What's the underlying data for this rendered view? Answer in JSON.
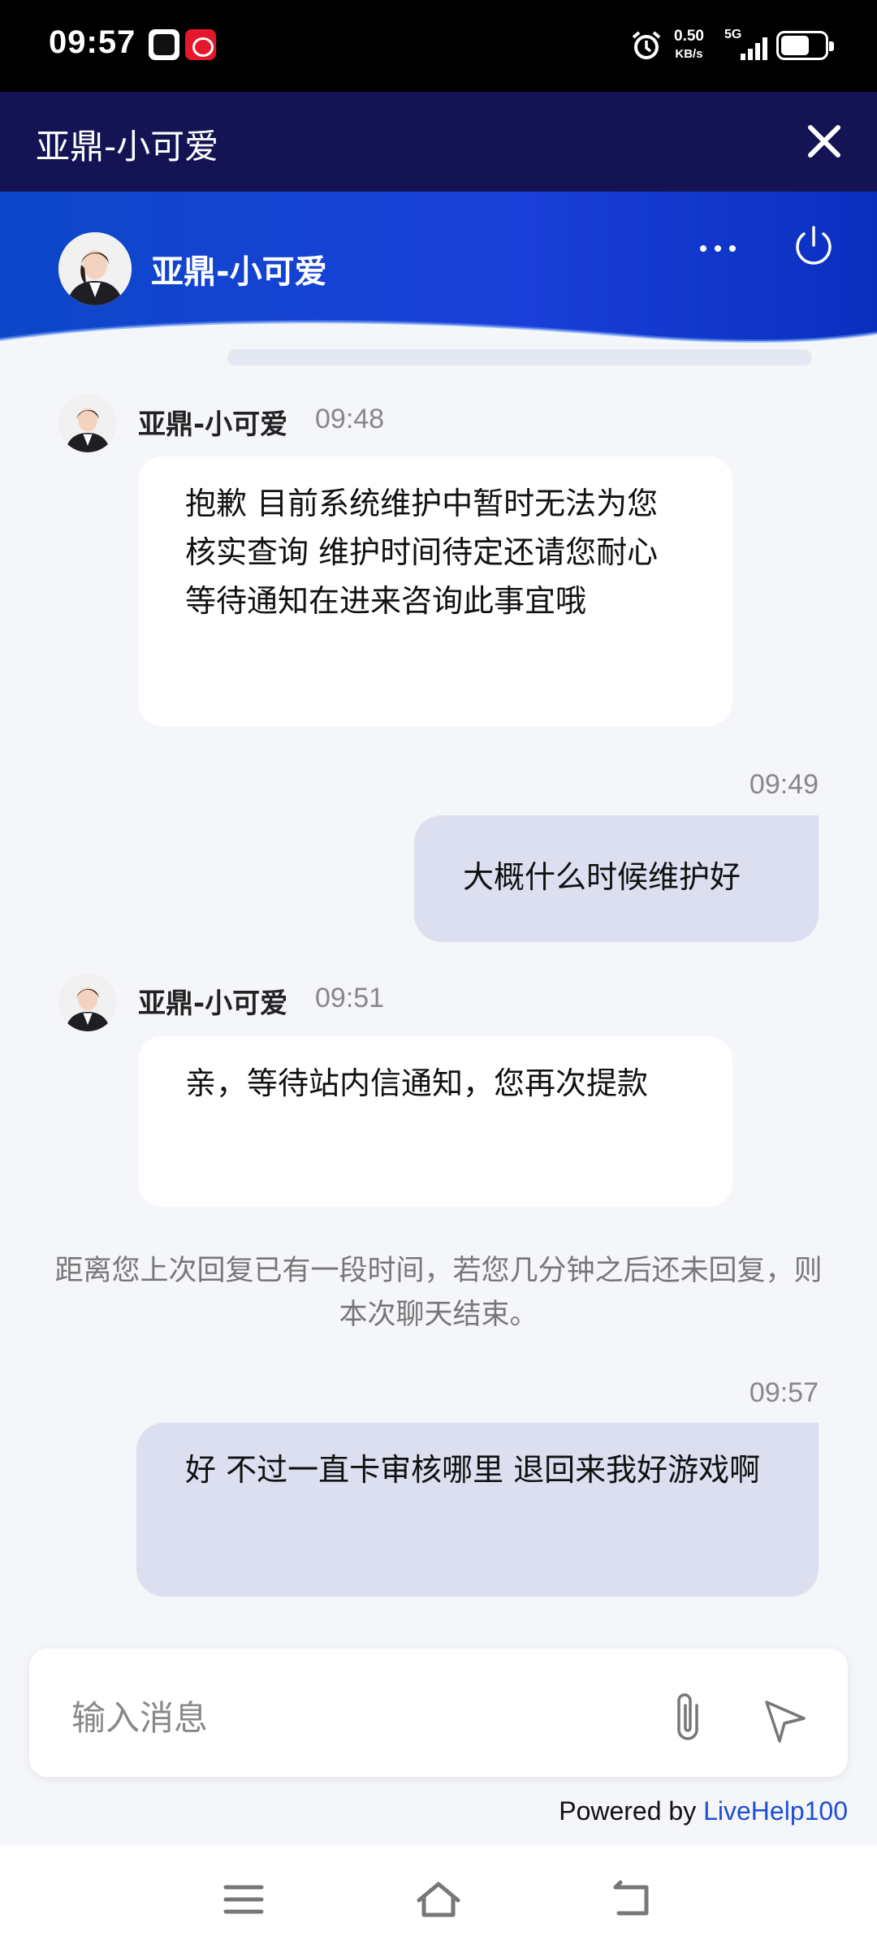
{
  "status_bar": {
    "time": "09:57",
    "speed_value": "0.50",
    "speed_unit": "KB/s",
    "network": "5G"
  },
  "titlebar": {
    "title": "亚鼎-小可爱"
  },
  "chat_header": {
    "agent_name": "亚鼎-小可爱"
  },
  "messages": [
    {
      "sender": "亚鼎-小可爱",
      "time": "09:48",
      "text": "抱歉 目前系统维护中暂时无法为您核实查询 维护时间待定还请您耐心等待通知在进来咨询此事宜哦"
    },
    {
      "time": "09:49",
      "text": "大概什么时候维护好"
    },
    {
      "sender": "亚鼎-小可爱",
      "time": "09:51",
      "text": "亲，等待站内信通知，您再次提款"
    },
    {
      "system": "距离您上次回复已有一段时间，若您几分钟之后还未回复，则本次聊天结束。"
    },
    {
      "time": "09:57",
      "text": "好 不过一直卡审核哪里 退回来我好游戏啊"
    }
  ],
  "composer": {
    "placeholder": "输入消息"
  },
  "footer": {
    "powered_prefix": "Powered by ",
    "powered_brand": "LiveHelp100"
  },
  "colors": {
    "title_bg": "#141455",
    "header_bg": "#1a3fd8",
    "outgoing_bubble": "#dcdff0",
    "incoming_bubble": "#ffffff",
    "link": "#1f4fd1"
  }
}
